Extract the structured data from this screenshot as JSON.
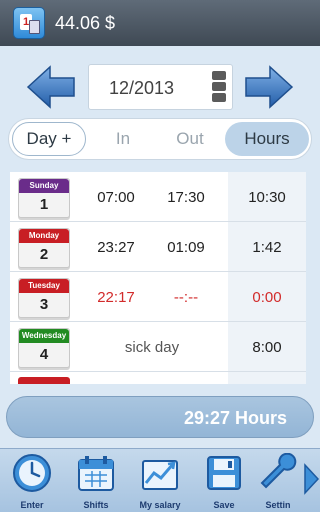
{
  "app": {
    "title": "44.06 $"
  },
  "nav": {
    "month": "12/2013"
  },
  "tabs": [
    {
      "label": "Day +"
    },
    {
      "label": "In"
    },
    {
      "label": "Out"
    },
    {
      "label": "Hours"
    }
  ],
  "rows": [
    {
      "day_name": "Sunday",
      "day_num": "1",
      "color": "#6a2c8a",
      "in": "07:00",
      "out": "17:30",
      "hours": "10:30"
    },
    {
      "day_name": "Monday",
      "day_num": "2",
      "color": "#c81e24",
      "in": "23:27",
      "out": "01:09",
      "hours": "1:42"
    },
    {
      "day_name": "Tuesday",
      "day_num": "3",
      "color": "#c81e24",
      "in": "22:17",
      "out": "--:--",
      "hours": "0:00"
    },
    {
      "day_name": "Wednesday",
      "day_num": "4",
      "color": "#228b22",
      "note": "sick day",
      "hours": "8:00"
    }
  ],
  "total": {
    "text": "29:27 Hours"
  },
  "toolbar": {
    "items": [
      {
        "label": "Enter",
        "icon": "clock-icon"
      },
      {
        "label": "Shifts",
        "icon": "calendar-icon"
      },
      {
        "label": "My salary",
        "icon": "chart-icon"
      },
      {
        "label": "Save",
        "icon": "floppy-icon"
      },
      {
        "label": "Settin",
        "icon": "wrench-icon"
      }
    ]
  },
  "colors": {
    "accent": "#3c7fc8",
    "title_bar": "#4b5663",
    "red_text": "#d22b2b"
  }
}
